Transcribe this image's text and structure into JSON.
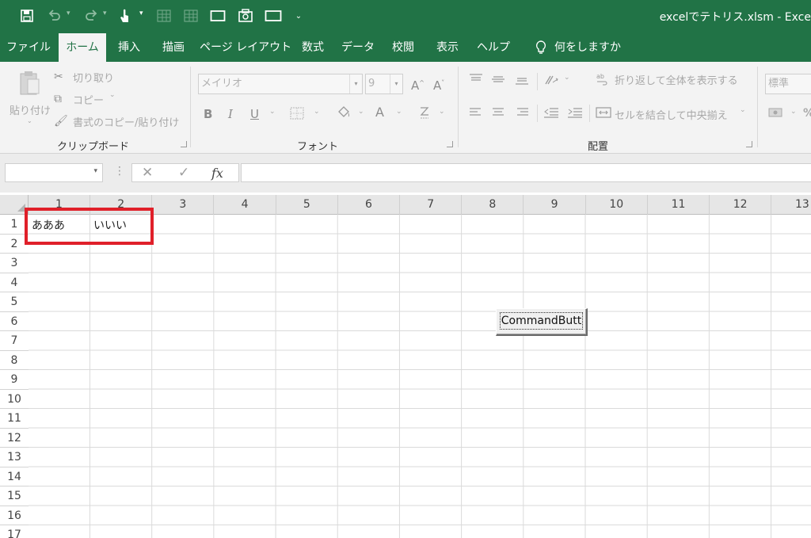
{
  "window": {
    "title": "excelでテトリス.xlsm  -  Exce"
  },
  "quick_access": {
    "icons": [
      "save-icon",
      "undo-icon",
      "redo-icon",
      "touch-mode-icon",
      "table-icon",
      "table-icon",
      "form-icon",
      "camera-icon",
      "rectangle-icon",
      "customize-icon"
    ]
  },
  "tabs": [
    {
      "label": "ファイル"
    },
    {
      "label": "ホーム",
      "active": true
    },
    {
      "label": "挿入"
    },
    {
      "label": "描画"
    },
    {
      "label": "ページ レイアウト"
    },
    {
      "label": "数式"
    },
    {
      "label": "データ"
    },
    {
      "label": "校閲"
    },
    {
      "label": "表示"
    },
    {
      "label": "ヘルプ"
    },
    {
      "label": "何をしますか"
    }
  ],
  "ribbon": {
    "clipboard": {
      "paste_label": "貼り付け",
      "cut_label": "切り取り",
      "copy_label": "コピー",
      "format_painter_label": "書式のコピー/貼り付け",
      "group_label": "クリップボード"
    },
    "font": {
      "font_name": "メイリオ",
      "font_size": "9",
      "grow_label": "A",
      "shrink_label": "A",
      "bold_label": "B",
      "italic_label": "I",
      "underline_label": "U",
      "font_color_label": "A",
      "group_label": "フォント"
    },
    "alignment": {
      "wrap_text_label": "折り返して全体を表示する",
      "merge_center_label": "セルを結合して中央揃え",
      "group_label": "配置"
    },
    "number": {
      "format_value": "標準"
    }
  },
  "formula_bar": {
    "name_box": "",
    "cancel_label": "✕",
    "enter_label": "✓",
    "fx_label": "fx",
    "formula": ""
  },
  "sheet": {
    "columns": [
      "1",
      "2",
      "3",
      "4",
      "5",
      "6",
      "7",
      "8",
      "9",
      "10",
      "11",
      "12",
      "13"
    ],
    "rows": [
      "1",
      "2",
      "3",
      "4",
      "5",
      "6",
      "7",
      "8",
      "9",
      "10",
      "11",
      "12",
      "13",
      "14",
      "15",
      "16",
      "17"
    ],
    "cells": [
      {
        "row": "1",
        "col": "1",
        "value": "あああ"
      },
      {
        "row": "1",
        "col": "2",
        "value": "いいい"
      }
    ],
    "highlight_color": "#e0202a"
  },
  "command_button": {
    "label": "CommandButt"
  },
  "colors": {
    "accent": "#217346",
    "ribbon_bg": "#f3f3f3"
  }
}
